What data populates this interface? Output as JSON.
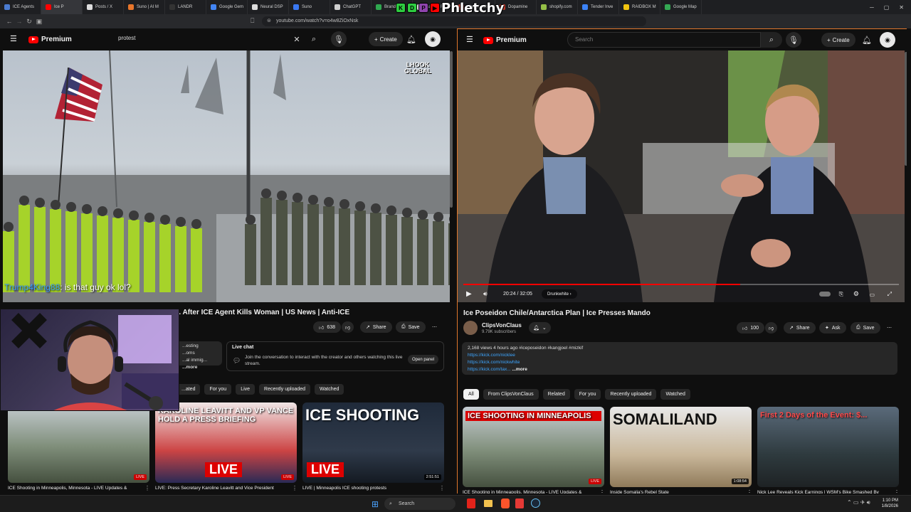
{
  "browser": {
    "tabs": [
      {
        "label": "ICE Agents",
        "color": "#4a7bd0"
      },
      {
        "label": "Ice P",
        "color": "#ff0000",
        "active": true
      },
      {
        "label": "Posts / X",
        "color": "#dddddd"
      },
      {
        "label": "Suno | AI M",
        "color": "#e8762b"
      },
      {
        "label": "LANDR",
        "color": "#333333"
      },
      {
        "label": "Google Gem",
        "color": "#4285f4"
      },
      {
        "label": "Neural DSP",
        "color": "#dddddd"
      },
      {
        "label": "Suno",
        "color": "#3a78f2"
      },
      {
        "label": "ChatGPT",
        "color": "#cfcfcf"
      },
      {
        "label": "Brand New",
        "color": "#2fa84f"
      },
      {
        "label": "Banner FBTI",
        "color": "#e0e0e0"
      },
      {
        "label": "Playing Card",
        "color": "#db4437"
      },
      {
        "label": "Dopamine",
        "color": "#c0392b"
      },
      {
        "label": "shopify.com",
        "color": "#95bf47"
      },
      {
        "label": "Tender Inve",
        "color": "#3b82f6"
      },
      {
        "label": "RAIDBOX M",
        "color": "#f1c40f"
      },
      {
        "label": "Google Map",
        "color": "#34a853"
      }
    ],
    "url": "youtube.com/watch?v=o4w8ZiOxNsk"
  },
  "overlay_logo": {
    "text": "Phletchy",
    "badges": [
      "K",
      "D",
      "P",
      "▶"
    ]
  },
  "left": {
    "logo": "Premium",
    "search_value": "protest",
    "create_label": "Create",
    "chat_user": "Trump4King88",
    "chat_text": ": is that guy ok lol?",
    "video_title": "ICE Agents Confront ... Protesters ... Minneapolis ... After ICE Agent Kills Woman | US News | Anti-ICE",
    "likes": "638",
    "share": "Share",
    "save": "Save",
    "desc_partial_1": "...esting",
    "desc_partial_2": "...oms",
    "desc_partial_3": "...al immig...",
    "more": "...more",
    "live_chat_title": "Live chat",
    "live_chat_text": "Join the conversation to interact with the creator and others watching this live stream.",
    "open_panel": "Open panel",
    "chips": [
      "...ated",
      "For you",
      "Live",
      "Recently uploaded",
      "Watched"
    ],
    "thumbs": [
      {
        "caption": "ICE Shooting in Minneapolis, Minnesota - LIVE Updates &",
        "badge": "LIVE"
      },
      {
        "caption": "LIVE: Press Secretary Karoline Leavitt and Vice President",
        "badge": "LIVE",
        "overlay": "KAROLINE LEAVITT AND VP VANCE HOLD A PRESS BRIEFING",
        "overlay2": "LIVE"
      },
      {
        "caption": "LIVE | Minneapolis ICE shooting protests",
        "duration": "2:51:51",
        "overlay": "ICE SHOOTING",
        "overlay2": "LIVE"
      }
    ],
    "watermark": "LHOOK GLOBAL"
  },
  "right": {
    "logo": "Premium",
    "search_placeholder": "Search",
    "create_label": "Create",
    "time": "20:24 / 32:05",
    "chapter": "Drunkwhite ›",
    "video_title": "Ice Poseidon Chile/Antarctica Plan | Ice Presses Mando",
    "channel": "ClipsVonClaus",
    "subs": "9.79K subscribers",
    "likes": "100",
    "share": "Share",
    "ask": "Ask",
    "save": "Save",
    "desc_meta": "2,168 views  4 hours ago  #iceposeidon #kangjoel #mizkif",
    "links": [
      "https://kick.com/nicklee",
      "https://kick.com/nickwhite",
      "https://kick.com/tax..."
    ],
    "more": "...more",
    "chips": [
      "All",
      "From ClipsVonClaus",
      "Related",
      "For you",
      "Recently uploaded",
      "Watched"
    ],
    "thumbs": [
      {
        "caption": "ICE Shooting in Minneapolis, Minnesota - LIVE Updates &",
        "overlay": "ICE SHOOTING IN MINNEAPOLIS",
        "badge": "LIVE"
      },
      {
        "caption": "Inside Somalia's Rebel State",
        "overlay": "SOMALILAND",
        "duration": "1:08:54"
      },
      {
        "caption": "Nick Lee Reveals Kick Earnings | WSM's Bike Smashed By",
        "overlay": "First 2 Days of the Event: $..."
      }
    ],
    "progress_fraction": 0.636
  },
  "taskbar": {
    "search": "Search",
    "time": "1:10 PM",
    "date": "1/8/2026"
  },
  "colors": {
    "accent": "#ff0000",
    "link": "#3ea6ff",
    "rightpane_border": "#e0762b"
  }
}
